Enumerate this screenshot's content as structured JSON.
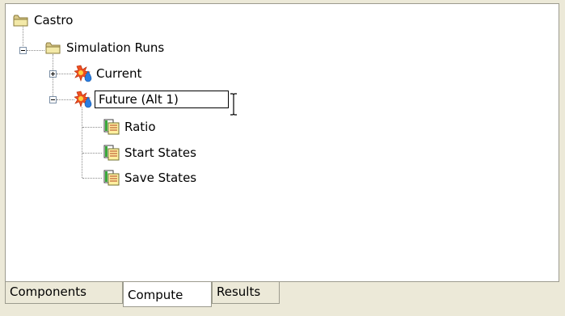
{
  "tree": {
    "root": {
      "label": "Castro",
      "icon": "folder-icon"
    },
    "simulation_runs": {
      "label": "Simulation Runs",
      "icon": "folder-icon",
      "expanded": true
    },
    "runs": [
      {
        "label": "Current",
        "icon": "simulation-run-icon",
        "expanded": false
      },
      {
        "label": "Future (Alt 1)",
        "icon": "simulation-run-icon",
        "expanded": true,
        "editing": true
      }
    ],
    "children": [
      {
        "label": "Ratio",
        "icon": "document-icon"
      },
      {
        "label": "Start States",
        "icon": "document-icon"
      },
      {
        "label": "Save States",
        "icon": "document-icon"
      }
    ]
  },
  "tabs": [
    {
      "label": "Components",
      "active": false
    },
    {
      "label": "Compute",
      "active": true
    },
    {
      "label": "Results",
      "active": false
    }
  ]
}
